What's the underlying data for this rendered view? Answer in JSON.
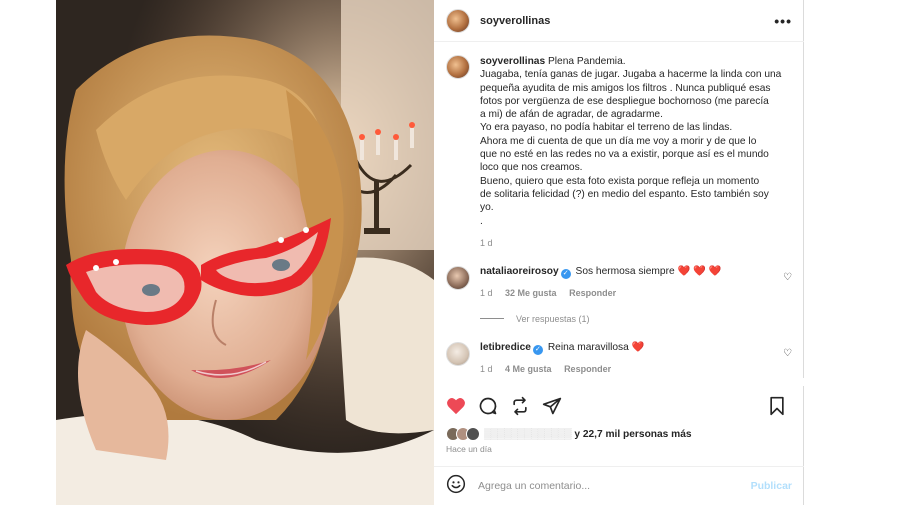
{
  "post": {
    "username": "soyverollinas",
    "more_icon": "ellipsis-icon",
    "more_glyph": "•••"
  },
  "caption": {
    "username": "soyverollinas",
    "title": "Plena Pandemia.",
    "lines": [
      "Juagaba, tenía ganas de jugar. Jugaba a hacerme la linda con una",
      "pequeña ayudita de mis amigos los filtros . Nunca publiqué esas",
      "fotos por vergüenza de ese despliegue bochornoso (me parecía",
      "a mi) de afán de agradar, de agradarme.",
      "Yo era payaso, no podía habitar el terreno de las lindas.",
      "Ahora me di cuenta de que un día me voy a morir y de que lo",
      "que no esté en las redes no va a existir, porque así es el mundo",
      "loco que nos creamos.",
      "Bueno, quiero que esta foto exista porque refleja un momento",
      "de solitaria felicidad (?) en medio del espanto. Esto también soy",
      "yo.",
      "."
    ],
    "age": "1 d"
  },
  "comments": [
    {
      "username": "nataliaoreirosoy",
      "verified": true,
      "text": "Sos hermosa siempre",
      "emoji": "❤️ ❤️ ❤️",
      "age": "1 d",
      "likes": "32 Me gusta",
      "reply": "Responder",
      "replies": "Ver respuestas (1)"
    },
    {
      "username": "letibredice",
      "verified": true,
      "text": "Reina maravillosa",
      "emoji": "❤️",
      "age": "1 d",
      "likes": "4 Me gusta",
      "reply": "Responder"
    }
  ],
  "actions": {
    "like_icon": "heart-filled-icon",
    "comment_icon": "comment-icon",
    "repost_icon": "repost-icon",
    "share_icon": "share-icon",
    "save_icon": "bookmark-icon",
    "like_color": "#ed4956"
  },
  "likes": {
    "blurred": "",
    "text": "y 22,7 mil personas más"
  },
  "timestamp": "Hace un día",
  "composer": {
    "emoji_icon": "smiley-icon",
    "placeholder": "Agrega un comentario...",
    "publish": "Publicar",
    "publish_color": "#b2dffc"
  },
  "colors": {
    "glasses": "#e8272b",
    "verified": "#3897f0",
    "heart": "#ed4956"
  }
}
